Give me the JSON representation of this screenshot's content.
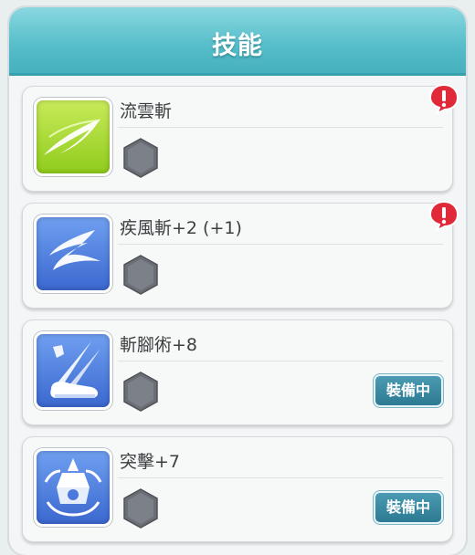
{
  "header": {
    "title": "技能"
  },
  "skills": [
    {
      "name": "流雲斬",
      "icon": "crescent-slash-icon",
      "alert": true,
      "equipped": false
    },
    {
      "name": "疾風斬+2 (+1)",
      "icon": "wind-slash-icon",
      "alert": true,
      "equipped": false
    },
    {
      "name": "斬腳術+8",
      "icon": "leg-slash-icon",
      "alert": false,
      "equipped": true,
      "badge": "裝備中"
    },
    {
      "name": "突擊+7",
      "icon": "charge-attack-icon",
      "alert": false,
      "equipped": true,
      "badge": "裝備中"
    }
  ],
  "colors": {
    "header": "#58bfcb",
    "badge": "#2d7a93",
    "alert": "#e02a3a",
    "icon_green": "#a5d92c",
    "icon_blue": "#4a78dc"
  }
}
